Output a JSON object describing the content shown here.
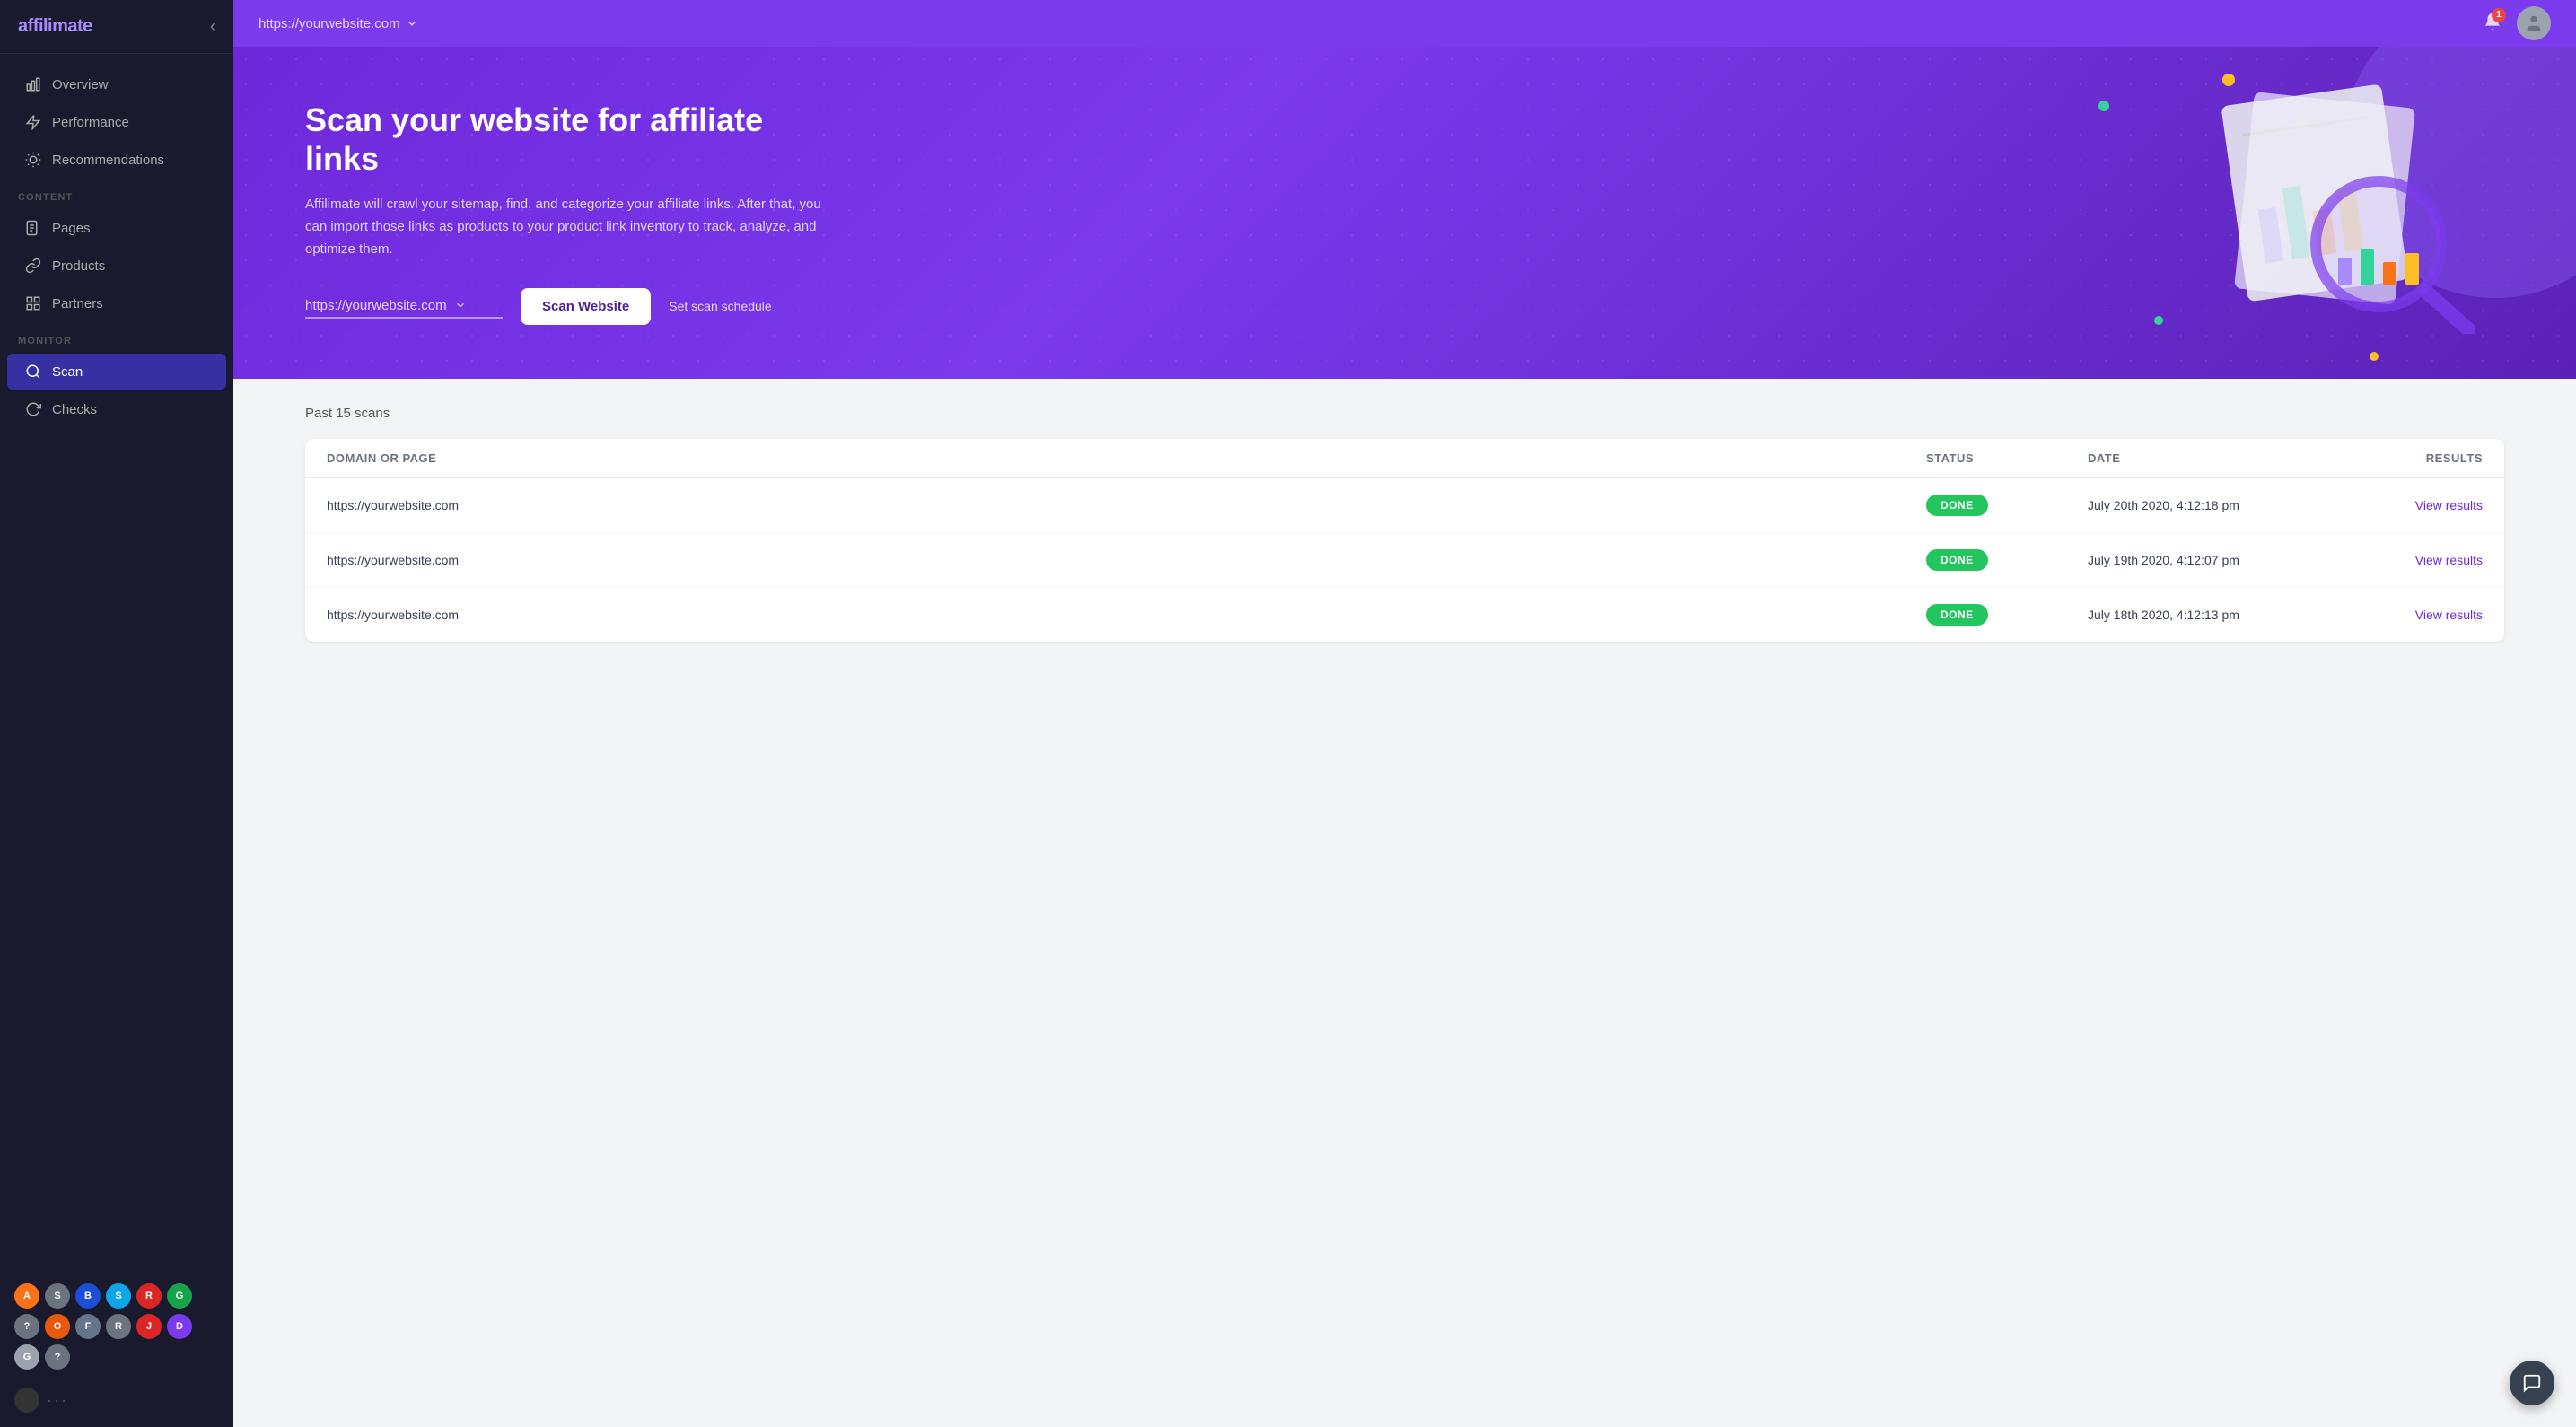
{
  "app": {
    "name": "affilimate",
    "logo_accent": "·"
  },
  "topbar": {
    "url": "https://yourwebsite.com",
    "notification_count": "1"
  },
  "sidebar": {
    "collapse_icon": "‹",
    "nav_items": [
      {
        "id": "overview",
        "label": "Overview",
        "icon": "bar-chart"
      },
      {
        "id": "performance",
        "label": "Performance",
        "icon": "lightning"
      },
      {
        "id": "recommendations",
        "label": "Recommendations",
        "icon": "sun"
      }
    ],
    "content_section_label": "CONTENT",
    "content_items": [
      {
        "id": "pages",
        "label": "Pages",
        "icon": "document"
      },
      {
        "id": "products",
        "label": "Products",
        "icon": "link"
      },
      {
        "id": "partners",
        "label": "Partners",
        "icon": "grid"
      }
    ],
    "monitor_section_label": "MONITOR",
    "monitor_items": [
      {
        "id": "scan",
        "label": "Scan",
        "icon": "search",
        "active": true
      },
      {
        "id": "checks",
        "label": "Checks",
        "icon": "refresh"
      }
    ],
    "partner_icons": [
      {
        "id": "amazon",
        "label": "A",
        "color": "#f97316"
      },
      {
        "id": "shareasale",
        "label": "S",
        "color": "#6b7280"
      },
      {
        "id": "bold",
        "label": "B",
        "color": "#1d4ed8"
      },
      {
        "id": "skimlinks",
        "label": "S",
        "color": "#0ea5e9"
      },
      {
        "id": "red",
        "label": "R",
        "color": "#dc2626"
      },
      {
        "id": "green",
        "label": "G",
        "color": "#16a34a"
      },
      {
        "id": "help",
        "label": "?",
        "color": "#6b7280"
      },
      {
        "id": "orange2",
        "label": "O",
        "color": "#ea580c"
      },
      {
        "id": "gray2",
        "label": "F",
        "color": "#64748b"
      },
      {
        "id": "rupee",
        "label": "R",
        "color": "#6b7280"
      },
      {
        "id": "jp",
        "label": "J",
        "color": "#dc2626"
      },
      {
        "id": "dark",
        "label": "D",
        "color": "#7c3aed"
      },
      {
        "id": "gray3",
        "label": "G",
        "color": "#9ca3af"
      },
      {
        "id": "help2",
        "label": "?",
        "color": "#6b7280"
      }
    ]
  },
  "hero": {
    "title": "Scan your website for affiliate links",
    "description": "Affilimate will crawl your sitemap, find, and categorize your affiliate links. After that, you can import those links as products to your product link inventory to track, analyze, and optimize them.",
    "url_dropdown": "https://yourwebsite.com",
    "scan_button": "Scan Website",
    "schedule_link": "Set scan schedule"
  },
  "results": {
    "section_title": "Past 15 scans",
    "columns": [
      "Domain or Page",
      "Status",
      "Date",
      "Results"
    ],
    "rows": [
      {
        "domain": "https://yourwebsite.com",
        "status": "DONE",
        "date": "July 20th 2020, 4:12:18 pm",
        "results": "View results"
      },
      {
        "domain": "https://yourwebsite.com",
        "status": "DONE",
        "date": "July 19th 2020, 4:12:07 pm",
        "results": "View results"
      },
      {
        "domain": "https://yourwebsite.com",
        "status": "DONE",
        "date": "July 18th 2020, 4:12:13 pm",
        "results": "View results"
      }
    ]
  }
}
